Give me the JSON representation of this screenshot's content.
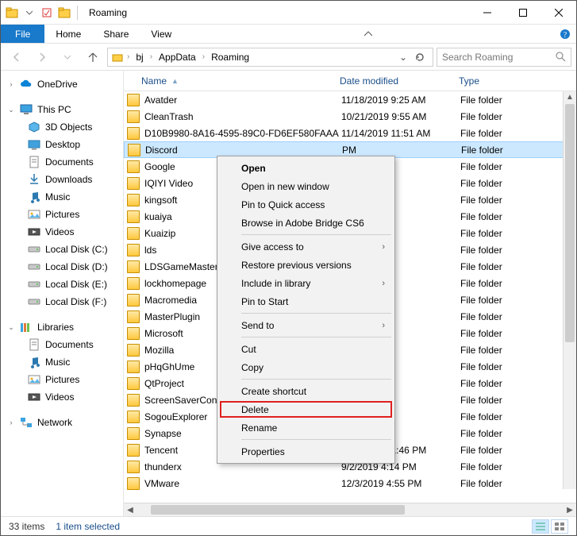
{
  "title": "Roaming",
  "ribbon": {
    "file": "File",
    "home": "Home",
    "share": "Share",
    "view": "View"
  },
  "breadcrumb": {
    "parts": [
      "bj",
      "AppData",
      "Roaming"
    ]
  },
  "search": {
    "placeholder": "Search Roaming"
  },
  "columns": {
    "name": "Name",
    "date": "Date modified",
    "type": "Type"
  },
  "nav": {
    "onedrive": "OneDrive",
    "thispc": "This PC",
    "thispc_items": [
      "3D Objects",
      "Desktop",
      "Documents",
      "Downloads",
      "Music",
      "Pictures",
      "Videos",
      "Local Disk (C:)",
      "Local Disk (D:)",
      "Local Disk  (E:)",
      "Local Disk (F:)"
    ],
    "libraries": "Libraries",
    "libraries_items": [
      "Documents",
      "Music",
      "Pictures",
      "Videos"
    ],
    "network": "Network"
  },
  "rows": [
    {
      "name": "Avatder",
      "date": "11/18/2019 9:25 AM",
      "type": "File folder"
    },
    {
      "name": "CleanTrash",
      "date": "10/21/2019 9:55 AM",
      "type": "File folder"
    },
    {
      "name": "D10B9980-8A16-4595-89C0-FD6EF580FAAA",
      "date": "11/14/2019 11:51 AM",
      "type": "File folder"
    },
    {
      "name": "Discord",
      "date": "PM",
      "type": "File folder",
      "selected": true
    },
    {
      "name": "Google",
      "date": "PM",
      "type": "File folder"
    },
    {
      "name": "IQIYI Video",
      "date": "0 PM",
      "type": "File folder"
    },
    {
      "name": "kingsoft",
      "date": "PM",
      "type": "File folder"
    },
    {
      "name": "kuaiya",
      "date": "AM",
      "type": "File folder"
    },
    {
      "name": "Kuaizip",
      "date": "PM",
      "type": "File folder"
    },
    {
      "name": "lds",
      "date": "PM",
      "type": "File folder"
    },
    {
      "name": "LDSGameMaster",
      "date": "PM",
      "type": "File folder"
    },
    {
      "name": "lockhomepage",
      "date": "53 AM",
      "type": "File folder"
    },
    {
      "name": "Macromedia",
      "date": "3 AM",
      "type": "File folder"
    },
    {
      "name": "MasterPlugin",
      "date": "51 AM",
      "type": "File folder"
    },
    {
      "name": "Microsoft",
      "date": "AM",
      "type": "File folder"
    },
    {
      "name": "Mozilla",
      "date": "AM",
      "type": "File folder"
    },
    {
      "name": "pHqGhUme",
      "date": "AM",
      "type": "File folder"
    },
    {
      "name": "QtProject",
      "date": "PM",
      "type": "File folder"
    },
    {
      "name": "ScreenSaverConfig",
      "date": "AM",
      "type": "File folder"
    },
    {
      "name": "SogouExplorer",
      "date": "3 PM",
      "type": "File folder"
    },
    {
      "name": "Synapse",
      "date": "PM",
      "type": "File folder"
    },
    {
      "name": "Tencent",
      "date": "11/14/2019 1:46 PM",
      "type": "File folder"
    },
    {
      "name": "thunderx",
      "date": "9/2/2019 4:14 PM",
      "type": "File folder"
    },
    {
      "name": "VMware",
      "date": "12/3/2019 4:55 PM",
      "type": "File folder"
    }
  ],
  "context": {
    "open": "Open",
    "open_new": "Open in new window",
    "pin_qa": "Pin to Quick access",
    "bridge": "Browse in Adobe Bridge CS6",
    "give": "Give access to",
    "restore": "Restore previous versions",
    "include": "Include in library",
    "pin_start": "Pin to Start",
    "send": "Send to",
    "cut": "Cut",
    "copy": "Copy",
    "shortcut": "Create shortcut",
    "delete": "Delete",
    "rename": "Rename",
    "props": "Properties"
  },
  "status": {
    "count": "33 items",
    "sel": "1 item selected"
  }
}
